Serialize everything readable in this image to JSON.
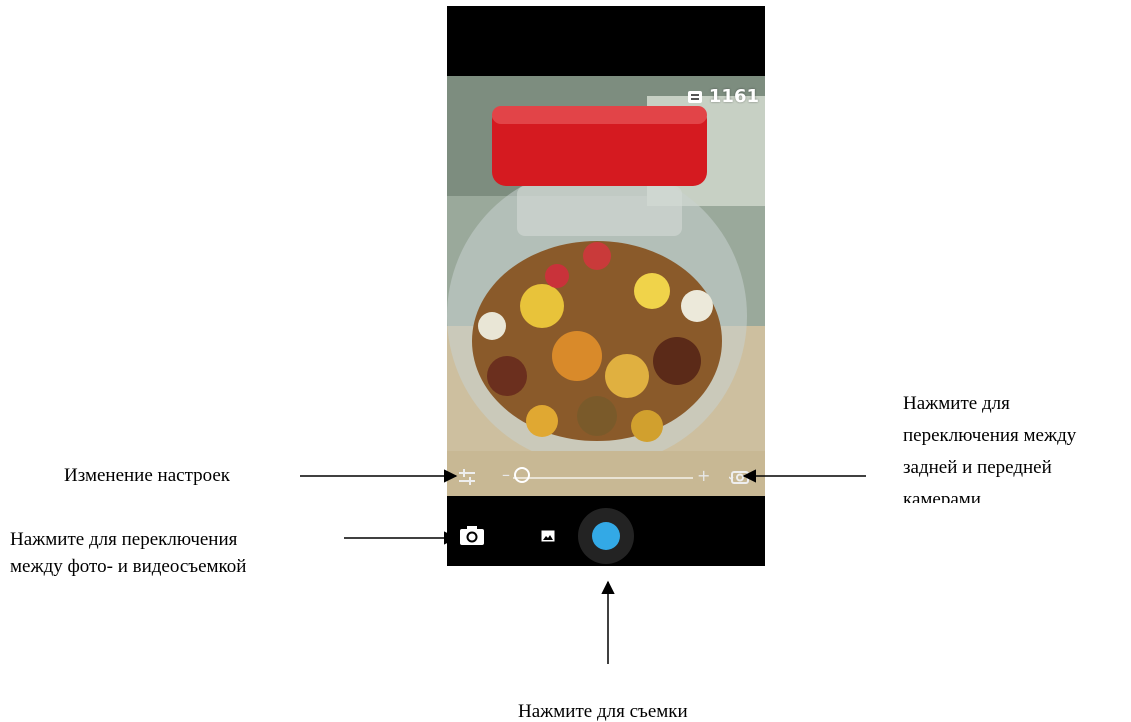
{
  "camera": {
    "remaining_shots": "1161",
    "zoom_minus": "–",
    "zoom_plus": "+",
    "zoom_level": 0.0,
    "shutter_color": "#33a9e6",
    "icons": {
      "storage": "sd-card-icon",
      "settings": "sliders-icon",
      "switch_camera": "camera-switch-icon",
      "mode_switch": "camera-icon",
      "gallery": "image-icon"
    }
  },
  "annotations": {
    "settings": "Изменение настроек",
    "mode_switch_line1": "Нажмите для переключения",
    "mode_switch_line2": "между фото- и видеосъемкой",
    "switch_camera_line1": "Нажмите для",
    "switch_camera_line2": "переключения между",
    "switch_camera_line3": "задней и передней",
    "switch_camera_line4": "камерами",
    "shutter": "Нажмите для съемки"
  }
}
